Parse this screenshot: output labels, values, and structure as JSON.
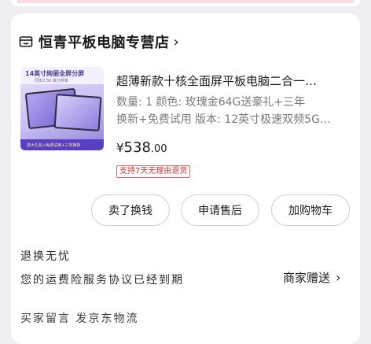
{
  "store": {
    "icon": "store-icon",
    "name": "恒青平板电脑专营店",
    "chevron": "›"
  },
  "product": {
    "thumb_banner_title": "14英寸绚丽全屏分屏",
    "thumb_banner_sub": "同步2.5K 真分辨率",
    "thumb_footer": "送大礼包+免费试用+三年换新",
    "title": "超薄新款十核全面屏平板电脑二合一…",
    "spec_line1": "数量: 1  颜色: 玫瑰金64G送豪礼+三年",
    "spec_line2": "换新+免费试用  版本: 12英寸极速双频5G…",
    "price_symbol": "¥",
    "price_integer": "538",
    "price_decimal": ".00",
    "badge": "支持7天无理由退货"
  },
  "actions": {
    "sell": "卖了换钱",
    "after_sales": "申请售后",
    "add_cart": "加购物车"
  },
  "notes": {
    "line1": "退换无忧",
    "line2": "您的运费险服务协议已经到期",
    "gift_label": "商家赠送",
    "gift_chevron": "›",
    "line3": "买家留言   发京东物流"
  }
}
